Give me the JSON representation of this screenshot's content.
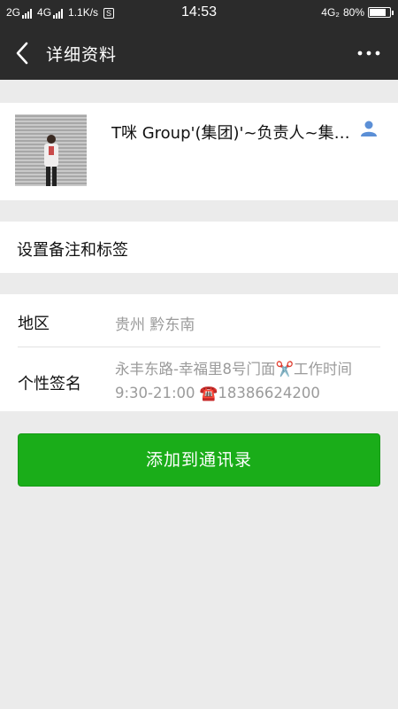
{
  "status_bar": {
    "network1": "2G",
    "network2": "4G",
    "speed": "1.1K/s",
    "s_icon_text": "S",
    "time": "14:53",
    "network3": "4G₂",
    "battery": "80%",
    "battery_level": 0.8
  },
  "nav": {
    "title": "详细资料",
    "back_icon": "chevron-left-icon",
    "more_icon": "more-dots-icon"
  },
  "profile": {
    "name": "T咪 Group'(集团)'~负责人~集团总监",
    "contact_icon": "person-icon",
    "contact_icon_color": "#5b8fd6"
  },
  "remark": {
    "label": "设置备注和标签"
  },
  "info": {
    "region_label": "地区",
    "region_value": "贵州  黔东南",
    "signature_label": "个性签名",
    "signature_value": "永丰东路-幸福里8号门面✂️工作时间9:30-21:00 ☎️18386624200"
  },
  "actions": {
    "add_button_label": "添加到通讯录",
    "add_button_color": "#1aad19"
  }
}
